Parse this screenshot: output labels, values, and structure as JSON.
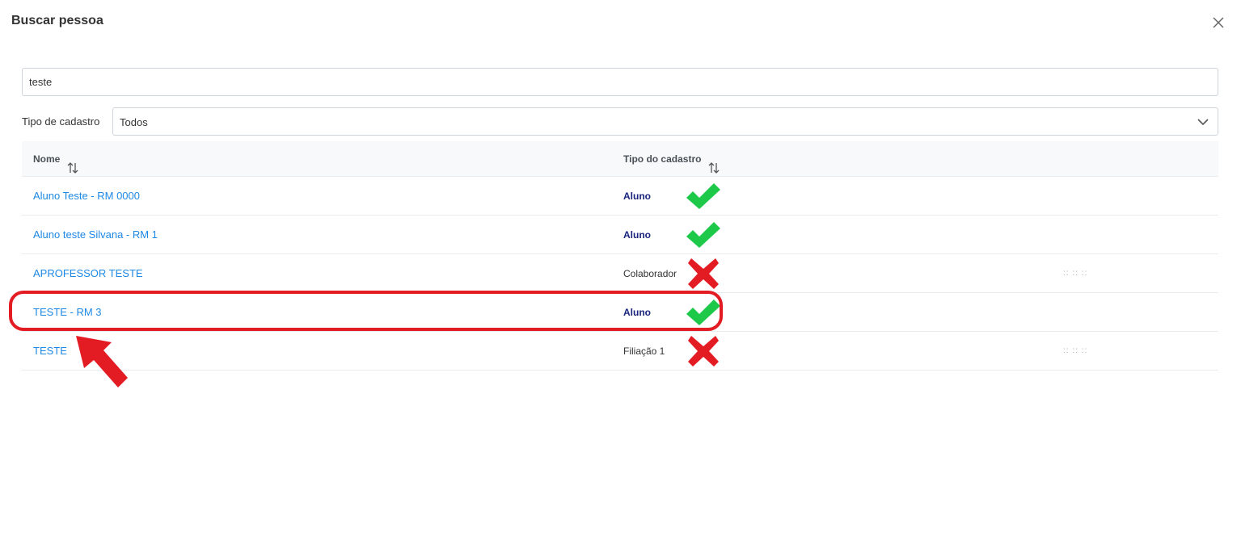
{
  "dialog": {
    "title": "Buscar pessoa",
    "close_icon": "close-icon"
  },
  "search": {
    "value": "teste"
  },
  "filter": {
    "label": "Tipo de cadastro",
    "selected": "Todos",
    "chevron_icon": "chevron-down-icon"
  },
  "table": {
    "columns": [
      {
        "label": "Nome",
        "sort_icon": "sort-icon"
      },
      {
        "label": "Tipo do cadastro",
        "sort_icon": "sort-icon"
      }
    ],
    "rows": [
      {
        "name": "Aluno Teste - RM 0000",
        "tipo": "Aluno",
        "mark": "check-icon",
        "extra": ""
      },
      {
        "name": "Aluno teste Silvana - RM 1",
        "tipo": "Aluno",
        "mark": "check-icon",
        "extra": ""
      },
      {
        "name": "APROFESSOR TESTE",
        "tipo": "Colaborador",
        "mark": "cross-icon",
        "extra": ":: :: ::"
      },
      {
        "name": "TESTE - RM 3",
        "tipo": "Aluno",
        "mark": "check-icon",
        "extra": ""
      },
      {
        "name": "TESTE",
        "tipo": "Filiação 1",
        "mark": "cross-icon",
        "extra": ":: :: ::"
      }
    ]
  },
  "annotations": {
    "highlighted_row": 3,
    "colors": {
      "highlight": "#e31b23",
      "check": "#1ec94a",
      "cross": "#e31b23",
      "link": "#1e88e5"
    }
  }
}
